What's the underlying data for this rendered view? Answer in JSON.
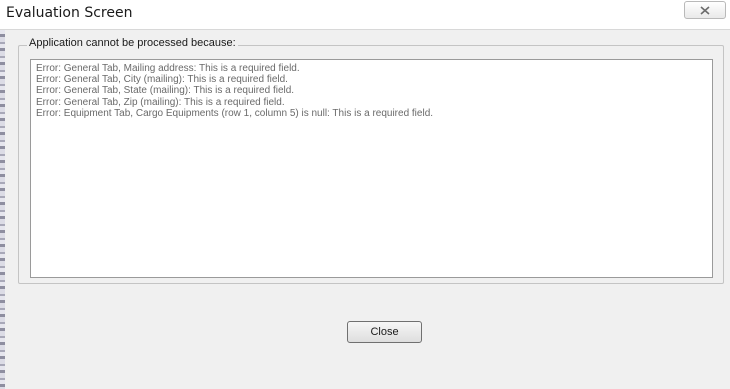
{
  "window": {
    "title": "Evaluation Screen",
    "close_icon": "close-x-icon"
  },
  "group": {
    "legend": "Application cannot be processed because:",
    "messages": [
      "Error: General Tab, Mailing address: This is a required field.",
      "Error: General Tab, City (mailing): This is a required field.",
      "Error: General Tab, State (mailing): This is a required field.",
      "Error: General Tab, Zip (mailing): This is a required field.",
      "Error: Equipment Tab, Cargo Equipments (row 1, column 5) is null: This is a required field."
    ]
  },
  "footer": {
    "close_label": "Close"
  }
}
